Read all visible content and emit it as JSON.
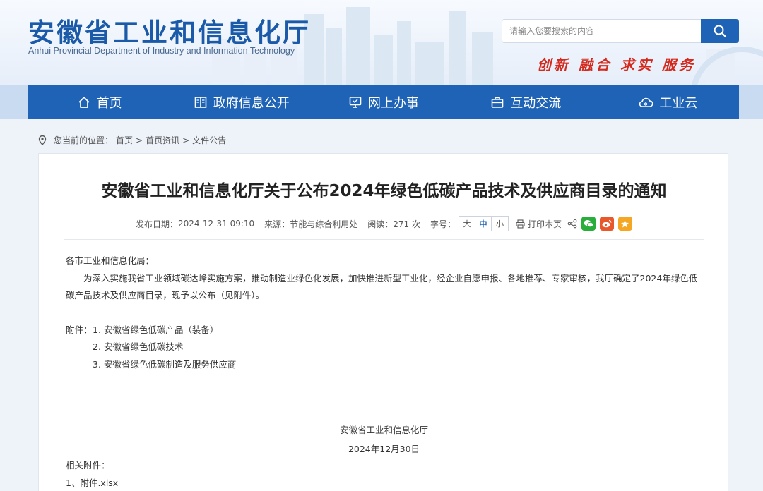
{
  "header": {
    "title": "安徽省工业和信息化厅",
    "subtitle": "Anhui Provincial Department of Industry and Information Technology",
    "slogan": "创新 融合 求实 服务",
    "search_placeholder": "请输入您要搜索的内容"
  },
  "nav": {
    "items": [
      {
        "label": "首页",
        "icon": "home-icon"
      },
      {
        "label": "政府信息公开",
        "icon": "book-icon"
      },
      {
        "label": "网上办事",
        "icon": "monitor-icon"
      },
      {
        "label": "互动交流",
        "icon": "briefcase-icon"
      },
      {
        "label": "工业云",
        "icon": "cloud-icon"
      }
    ]
  },
  "breadcrumb": {
    "prefix": "您当前的位置：",
    "items": [
      "首页",
      "首页资讯",
      "文件公告"
    ],
    "separator": ">"
  },
  "article": {
    "title": "安徽省工业和信息化厅关于公布2024年绿色低碳产品技术及供应商目录的通知",
    "meta": {
      "date_label": "发布日期：",
      "date": "2024-12-31 09:10",
      "source_label": "来源：",
      "source": "节能与综合利用处",
      "views_label": "阅读：",
      "views": "271 次",
      "size_label": "字号：",
      "sizes": [
        "大",
        "中",
        "小"
      ],
      "print_label": "打印本页"
    },
    "salutation": "各市工业和信息化局：",
    "paragraph": "为深入实施我省工业领域碳达峰实施方案，推动制造业绿色化发展，加快推进新型工业化，经企业自愿申报、各地推荐、专家审核，我厅确定了2024年绿色低碳产品技术及供应商目录，现予以公布（见附件）。",
    "attachments_label": "附件：",
    "attachments": [
      "1. 安徽省绿色低碳产品（装备）",
      "2. 安徽省绿色低碳技术",
      "3. 安徽省绿色低碳制造及服务供应商"
    ],
    "signature": "安徽省工业和信息化厅",
    "sign_date": "2024年12月30日",
    "related_label": "相关附件：",
    "related_files": [
      "1、附件.xlsx"
    ]
  },
  "colors": {
    "brand": "#1e63b5",
    "slogan": "#d42a1e",
    "wechat": "#2aae3b",
    "weibo": "#e8582a",
    "favorite": "#f5a623"
  }
}
